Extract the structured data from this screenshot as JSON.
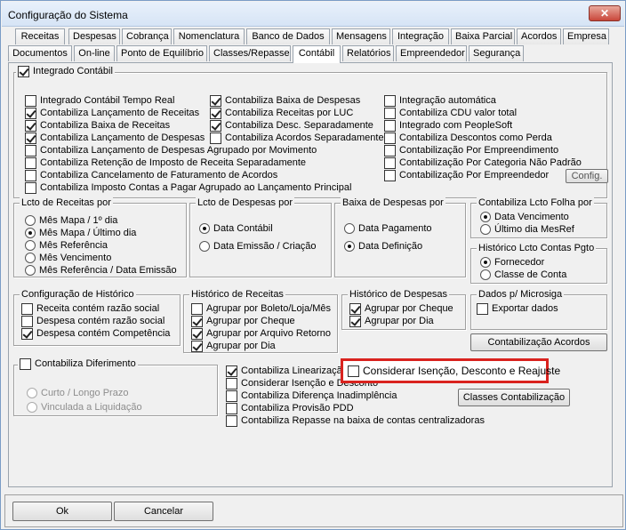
{
  "window": {
    "title": "Configuração do Sistema",
    "close_label": "✕"
  },
  "tabs_row1": [
    "Receitas",
    "Despesas",
    "Cobrança",
    "Nomenclatura",
    "Banco de Dados",
    "Mensagens",
    "Integração",
    "Baixa Parcial",
    "Acordos",
    "Empresa"
  ],
  "tabs_row2": [
    "Documentos",
    "On-line",
    "Ponto de Equilíbrio",
    "Classes/Repasse",
    "Contábil",
    "Relatórios",
    "Empreendedor",
    "Segurança"
  ],
  "integrado": {
    "label": "Integrado Contábil",
    "col1": [
      {
        "label": "Integrado Contábil Tempo Real",
        "checked": false
      },
      {
        "label": "Contabiliza Lançamento de Receitas",
        "checked": true
      },
      {
        "label": "Contabiliza Baixa de Receitas",
        "checked": true
      },
      {
        "label": "Contabiliza Lançamento de Despesas",
        "checked": true
      },
      {
        "label": "Contabiliza Lançamento de Despesas Agrupado por Movimento",
        "checked": false
      },
      {
        "label": "Contabiliza Retenção de Imposto de Receita Separadamente",
        "checked": false
      },
      {
        "label": "Contabiliza Cancelamento de Faturamento de Acordos",
        "checked": false
      },
      {
        "label": "Contabiliza Imposto Contas a Pagar Agrupado ao Lançamento Principal",
        "checked": false
      }
    ],
    "col2": [
      {
        "label": "Contabiliza Baixa de Despesas",
        "checked": true
      },
      {
        "label": "Contabiliza Receitas por LUC",
        "checked": true
      },
      {
        "label": "Contabiliza Desc. Separadamente",
        "checked": true
      },
      {
        "label": "Contabiliza Acordos Separadamente",
        "checked": false
      }
    ],
    "col3": [
      {
        "label": "Integração automática",
        "checked": false
      },
      {
        "label": "Contabiliza CDU valor total",
        "checked": false
      },
      {
        "label": "Integrado com PeopleSoft",
        "checked": false
      },
      {
        "label": "Contabiliza Descontos como Perda",
        "checked": false
      },
      {
        "label": "Contabilização Por Empreendimento",
        "checked": false
      },
      {
        "label": "Contabilização Por Categoria Não Padrão",
        "checked": false
      },
      {
        "label": "Contabilização Por Empreendedor",
        "checked": false
      }
    ],
    "config_button": "Config."
  },
  "lcto_receitas": {
    "title": "Lcto de Receitas por",
    "options": [
      "Mês Mapa / 1º dia",
      "Mês Mapa / Último dia",
      "Mês Referência",
      "Mês Vencimento",
      "Mês Referência / Data Emissão"
    ],
    "selected": 1
  },
  "lcto_despesas": {
    "title": "Lcto de Despesas por",
    "options": [
      "Data Contábil",
      "Data Emissão / Criação"
    ],
    "selected": 0
  },
  "baixa_despesas": {
    "title": "Baixa de Despesas por",
    "options": [
      "Data Pagamento",
      "Data Definição"
    ],
    "selected": 1
  },
  "folha": {
    "title": "Contabiliza Lcto Folha por",
    "options": [
      "Data Vencimento",
      "Último dia MesRef"
    ],
    "selected": 0
  },
  "historico_pgto": {
    "title": "Histórico Lcto Contas Pgto",
    "options": [
      "Fornecedor",
      "Classe de Conta"
    ],
    "selected": 0
  },
  "config_historico": {
    "title": "Configuração de Histórico",
    "items": [
      {
        "label": "Receita contém razão social",
        "checked": false
      },
      {
        "label": "Despesa contém razão social",
        "checked": false
      },
      {
        "label": "Despesa contém Competência",
        "checked": true
      }
    ]
  },
  "historico_receitas": {
    "title": "Histórico de Receitas",
    "items": [
      {
        "label": "Agrupar por Boleto/Loja/Mês",
        "checked": false
      },
      {
        "label": "Agrupar por Cheque",
        "checked": true
      },
      {
        "label": "Agrupar por Arquivo Retorno",
        "checked": true
      },
      {
        "label": "Agrupar por Dia",
        "checked": true
      }
    ]
  },
  "historico_despesas": {
    "title": "Histórico de Despesas",
    "items": [
      {
        "label": "Agrupar por Cheque",
        "checked": true
      },
      {
        "label": "Agrupar por Dia",
        "checked": true
      }
    ]
  },
  "microsiga": {
    "title": "Dados p/ Microsiga",
    "items": [
      {
        "label": "Exportar dados",
        "checked": false
      }
    ],
    "acordos_button": "Contabilização Acordos"
  },
  "diferimento": {
    "label": "Contabiliza Diferimento",
    "checked": false,
    "options": [
      "Curto / Longo Prazo",
      "Vinculada a Liquidação"
    ]
  },
  "bottom_checks": [
    {
      "label": "Contabiliza Linearização",
      "checked": true
    },
    {
      "label": "Considerar Isenção e Desconto",
      "checked": false
    },
    {
      "label": "Contabiliza Diferença Inadimplência",
      "checked": false
    },
    {
      "label": "Contabiliza Provisão PDD",
      "checked": false
    },
    {
      "label": "Contabiliza Repasse na baixa de contas centralizadoras",
      "checked": false
    }
  ],
  "highlight": {
    "label": "Considerar Isenção, Desconto e Reajuste",
    "checked": false,
    "accent": "#d9231f"
  },
  "classes_button": "Classes Contabilização",
  "footer": {
    "ok": "Ok",
    "cancel": "Cancelar"
  }
}
